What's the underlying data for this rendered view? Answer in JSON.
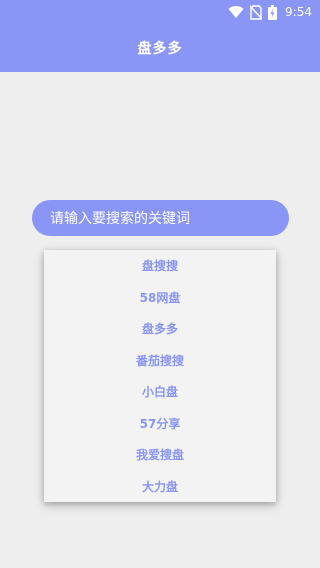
{
  "status_bar": {
    "time": "9:54",
    "icons": [
      "wifi-icon",
      "no-sim-icon",
      "battery-charging-icon"
    ]
  },
  "app_bar": {
    "title": "盘多多"
  },
  "search": {
    "placeholder": "请输入要搜索的关键词"
  },
  "dropdown": {
    "items": [
      "盘搜搜",
      "58网盘",
      "盘多多",
      "番茄搜搜",
      "小白盘",
      "57分享",
      "我爱搜盘",
      "大力盘"
    ]
  },
  "colors": {
    "accent": "#8a96f5",
    "background": "#eeeeee",
    "dropdown_bg": "#f3f3f3",
    "text_on_accent": "#ffffff"
  }
}
